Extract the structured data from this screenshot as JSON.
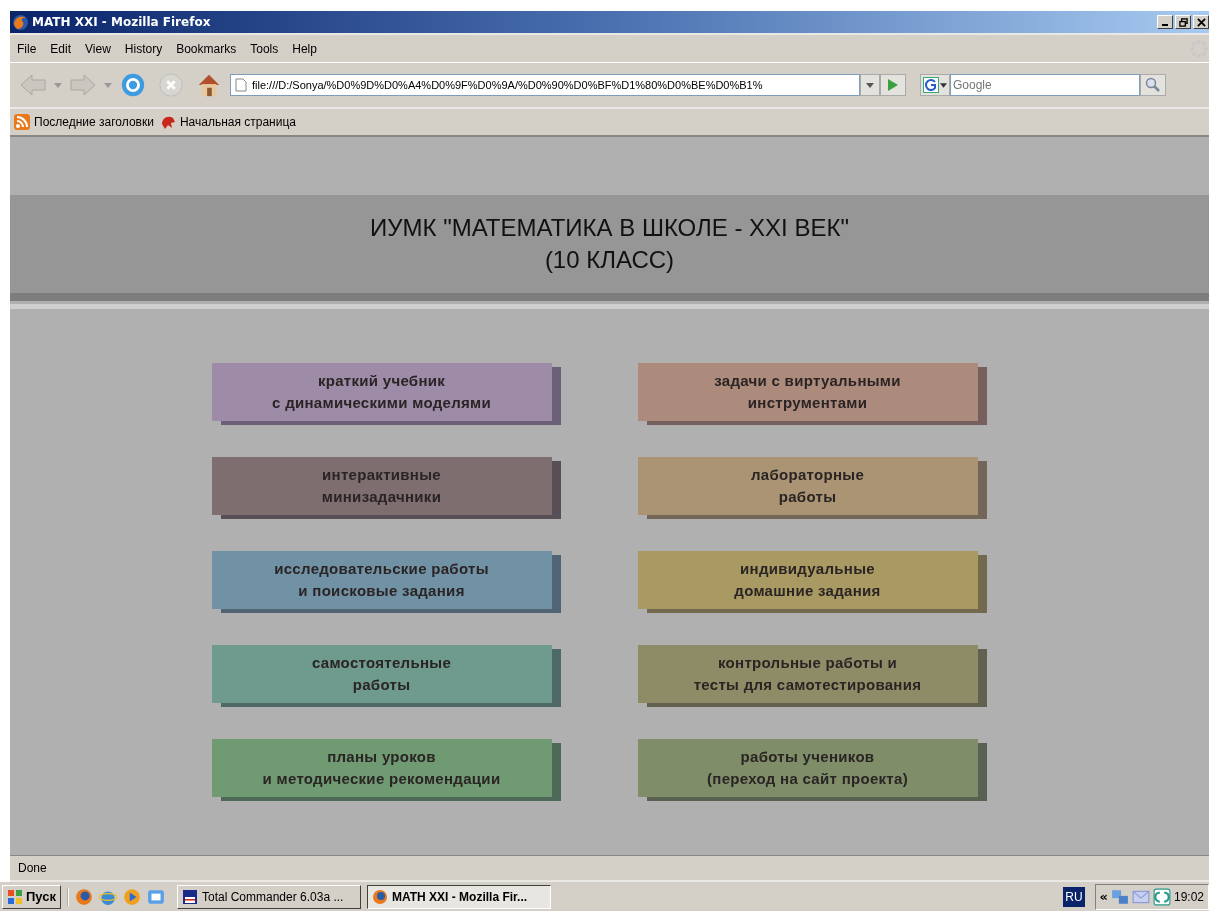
{
  "window": {
    "title": "MATH XXI - Mozilla Firefox"
  },
  "menu": [
    "File",
    "Edit",
    "View",
    "History",
    "Bookmarks",
    "Tools",
    "Help"
  ],
  "toolbar": {
    "address": "file:///D:/Sonya/%D0%9D%D0%A4%D0%9F%D0%9A/%D0%90%D0%BF%D1%80%D0%BE%D0%B1%",
    "search_placeholder": "Google"
  },
  "bookmarks": [
    "Последние заголовки",
    "Начальная страница"
  ],
  "page": {
    "title_line1": "ИУМК \"МАТЕМАТИКА В ШКОЛЕ - XXI ВЕК\"",
    "title_line2": "(10 КЛАСС)",
    "links": [
      {
        "lines": [
          "краткий учебник",
          "с динамическими моделями"
        ],
        "color": "#9e8ba8"
      },
      {
        "lines": [
          "задачи с виртуальными",
          "инструментами"
        ],
        "color": "#ad8b7c"
      },
      {
        "lines": [
          "интерактивные",
          "минизадачники"
        ],
        "color": "#7e6e70"
      },
      {
        "lines": [
          "лабораторные",
          "работы"
        ],
        "color": "#ab9474"
      },
      {
        "lines": [
          "исследовательские работы",
          "и поисковые задания"
        ],
        "color": "#7192a5"
      },
      {
        "lines": [
          "индивидуальные",
          "домашние задания"
        ],
        "color": "#a89a62"
      },
      {
        "lines": [
          "самостоятельные",
          "работы"
        ],
        "color": "#6f9a8e"
      },
      {
        "lines": [
          "контрольные работы и",
          "тесты для самотестирования"
        ],
        "color": "#8e8c66"
      },
      {
        "lines": [
          "планы уроков",
          "и методические рекомендации"
        ],
        "color": "#6f9a72"
      },
      {
        "lines": [
          "работы учеников",
          "(переход на сайт проекта)"
        ],
        "color": "#7f8e68"
      }
    ]
  },
  "status_bar": "Done",
  "taskbar": {
    "start": "Пуск",
    "tasks": [
      {
        "label": "Total Commander 6.03a ...",
        "selected": false
      },
      {
        "label": "MATH XXI - Mozilla Fir...",
        "selected": true
      }
    ],
    "language": "RU",
    "tray_expand": "«",
    "clock": "19:02"
  }
}
